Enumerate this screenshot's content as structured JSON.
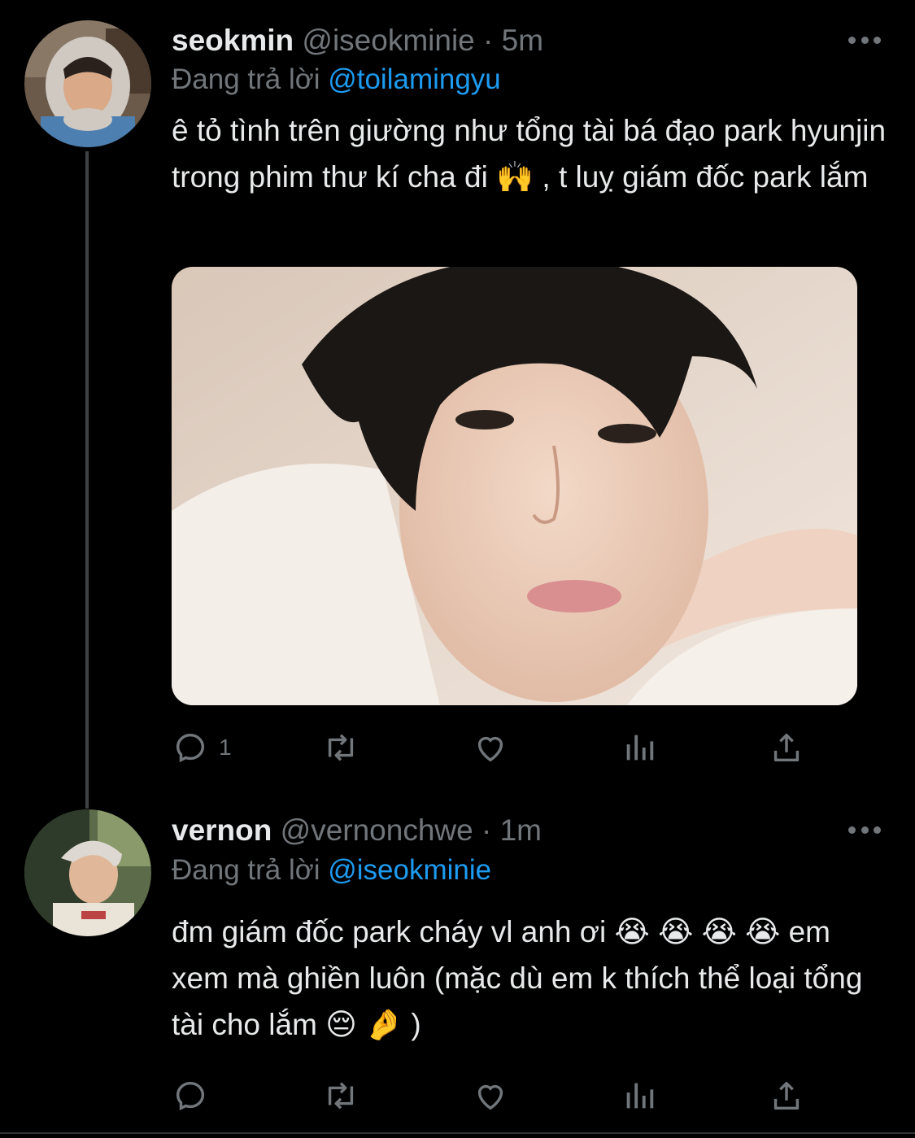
{
  "tweets": [
    {
      "name": "seokmin",
      "handle": "@iseokminie",
      "separator": "·",
      "time": "5m",
      "replying_prefix": "Đang trả lời",
      "replying_to": "@toilamingyu",
      "text": "ê tỏ tình trên giường như tổng tài bá đạo park hyunjin trong phim thư kí cha đi 🙌 , t luỵ giám đốc park lắm",
      "has_media": true,
      "actions": {
        "reply_count": "1",
        "retweet_count": "",
        "like_count": ""
      }
    },
    {
      "name": "vernon",
      "handle": "@vernonchwe",
      "separator": "·",
      "time": "1m",
      "replying_prefix": "Đang trả lời",
      "replying_to": "@iseokminie",
      "text": "đm giám đốc park cháy vl anh ơi 😭 😭 😭 😭  em xem mà ghiền luôn (mặc dù em k thích thể loại tổng tài cho lắm 😔 🤌 )",
      "has_media": false,
      "actions": {
        "reply_count": "",
        "retweet_count": "",
        "like_count": ""
      }
    }
  ],
  "colors": {
    "background": "#000000",
    "text_primary": "#e7e9ea",
    "text_secondary": "#71767b",
    "mention": "#1d9bf0",
    "thread_line": "#3e4144"
  },
  "icons": [
    "reply-icon",
    "retweet-icon",
    "like-icon",
    "analytics-icon",
    "share-icon",
    "more-icon"
  ]
}
